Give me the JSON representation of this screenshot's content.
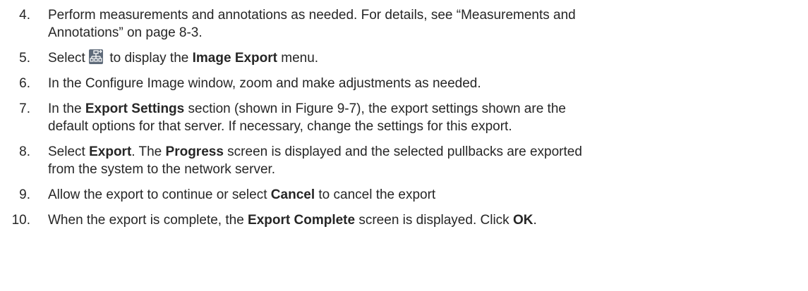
{
  "steps": [
    {
      "number": "4.",
      "line1": "Perform measurements and annotations as needed. For details, see “Measurements and",
      "line2": "Annotations” on page 8-3."
    },
    {
      "number": "5.",
      "pre": "Select",
      "icon": "image-export-icon",
      "mid": " to display the ",
      "bold": "Image Export",
      "post": " menu."
    },
    {
      "number": "6.",
      "text": "In the Configure Image window, zoom and make adjustments as needed."
    },
    {
      "number": "7.",
      "pre": "In the ",
      "bold": "Export Settings",
      "line1_post": " section (shown in Figure 9-7), the export settings shown are the",
      "line2": "default options for that server. If necessary, change the settings for this export."
    },
    {
      "number": "8.",
      "pre": "Select ",
      "bold1": "Export",
      "mid": ". The ",
      "bold2": "Progress",
      "line1_post": " screen is displayed and the selected pullbacks are exported",
      "line2": "from the system to the network server."
    },
    {
      "number": "9.",
      "pre": "Allow the export to continue or select ",
      "bold": "Cancel",
      "post": " to cancel the export"
    },
    {
      "number": "10.",
      "pre": "When the export is complete, the ",
      "bold1": "Export Complete",
      "mid": " screen is displayed. Click ",
      "bold2": "OK",
      "post": "."
    }
  ]
}
